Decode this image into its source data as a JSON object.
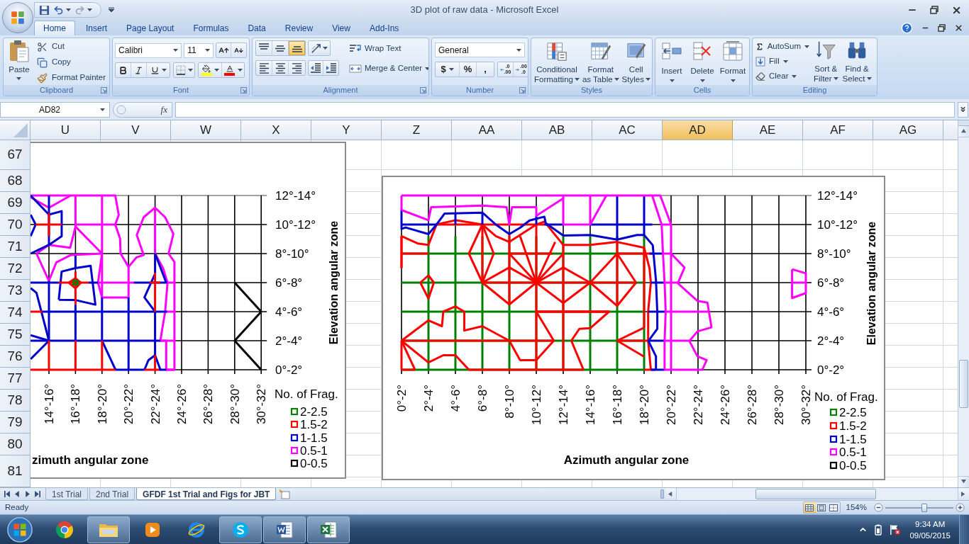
{
  "title_bar": {
    "title": "3D plot of raw data - Microsoft Excel"
  },
  "quick_access": [
    {
      "kind": "save",
      "disabled": false
    },
    {
      "kind": "undo",
      "disabled": false
    },
    {
      "kind": "redo",
      "disabled": true
    }
  ],
  "ribbon_tabs": [
    {
      "label": "Home",
      "selected": true
    },
    {
      "label": "Insert",
      "selected": false
    },
    {
      "label": "Page Layout",
      "selected": false
    },
    {
      "label": "Formulas",
      "selected": false
    },
    {
      "label": "Data",
      "selected": false
    },
    {
      "label": "Review",
      "selected": false
    },
    {
      "label": "View",
      "selected": false
    },
    {
      "label": "Add-Ins",
      "selected": false
    }
  ],
  "ribbon_groups": [
    {
      "kind": "clipboard",
      "name": "Clipboard",
      "paste": "Paste",
      "commands": [
        "Cut",
        "Copy",
        "Format Painter"
      ]
    },
    {
      "kind": "font",
      "name": "Font",
      "font_name": "Calibri",
      "font_size": "11"
    },
    {
      "kind": "alignment",
      "name": "Alignment",
      "vertical_align": [
        {
          "selected": false
        },
        {
          "selected": false
        },
        {
          "selected": true
        }
      ],
      "commands": [
        "Wrap Text",
        "Merge & Center"
      ]
    },
    {
      "kind": "number",
      "name": "Number",
      "format": "General",
      "symbols": [
        "$",
        "%",
        ","
      ],
      "decimals": [
        [
          ".0",
          ".00"
        ],
        [
          ".00",
          ".0"
        ]
      ]
    },
    {
      "kind": "styles",
      "name": "Styles",
      "commands": [
        [
          "Conditional",
          "Formatting"
        ],
        [
          "Format",
          "as Table"
        ],
        [
          "Cell",
          "Styles"
        ]
      ]
    },
    {
      "kind": "cells",
      "name": "Cells",
      "commands": [
        "Insert",
        "Delete",
        "Format"
      ]
    },
    {
      "kind": "editing",
      "name": "Editing",
      "commands": [
        "AutoSum",
        "Fill",
        "Clear"
      ],
      "large_commands": [
        [
          "Sort &",
          "Filter"
        ],
        [
          "Find &",
          "Select"
        ]
      ]
    }
  ],
  "formula_bar": {
    "name_box": "AD82",
    "function_label": "fx"
  },
  "columns": [
    {
      "label": "U",
      "selected": false
    },
    {
      "label": "V",
      "selected": false
    },
    {
      "label": "W",
      "selected": false
    },
    {
      "label": "X",
      "selected": false
    },
    {
      "label": "Y",
      "selected": false
    },
    {
      "label": "Z",
      "selected": false
    },
    {
      "label": "AA",
      "selected": false
    },
    {
      "label": "AB",
      "selected": false
    },
    {
      "label": "AC",
      "selected": false
    },
    {
      "label": "AD",
      "selected": true
    },
    {
      "label": "AE",
      "selected": false
    },
    {
      "label": "AF",
      "selected": false
    },
    {
      "label": "AG",
      "selected": false
    }
  ],
  "rows": [
    "67",
    "68",
    "69",
    "70",
    "71",
    "72",
    "73",
    "74",
    "75",
    "76",
    "77",
    "78",
    "79",
    "80",
    "81"
  ],
  "charts": [
    {
      "kind": "clipped",
      "x_tick_labels": [
        "14°-16°",
        "16°-18°",
        "18°-20°",
        "20°-22°",
        "22°-24°",
        "24°-26°",
        "26°-28°",
        "28°-30°",
        "30°-32°"
      ],
      "y_tick_labels": [
        "12°-14°",
        "10°-12°",
        "8°-10°",
        "6°-8°",
        "4°-6°",
        "2°-4°",
        "0°-2°"
      ],
      "y_axis_title": "Elevation angular zone",
      "x_axis_title": "zimuth angular zone",
      "legend_title": "No. of Frag.",
      "legend": [
        {
          "label": "2-2.5",
          "color": "#008000"
        },
        {
          "label": "1.5-2",
          "color": "#ff0000"
        },
        {
          "label": "1-1.5",
          "color": "#0000cc"
        },
        {
          "label": "0.5-1",
          "color": "#ff00ff"
        },
        {
          "label": "0-0.5",
          "color": "#000000"
        }
      ]
    },
    {
      "kind": "full",
      "x_tick_labels": [
        "0°-2°",
        "2°-4°",
        "4°-6°",
        "6°-8°",
        "8°-10°",
        "10°-12°",
        "12°-14°",
        "14°-16°",
        "16°-18°",
        "18°-20°",
        "20°-22°",
        "22°-24°",
        "24°-26°",
        "26°-28°",
        "28°-30°",
        "30°-32°"
      ],
      "y_tick_labels": [
        "12°-14°",
        "10°-12°",
        "8°-10°",
        "6°-8°",
        "4°-6°",
        "2°-4°",
        "0°-2°"
      ],
      "y_axis_title": "Elevation angular zone",
      "x_axis_title": "Azimuth angular zone",
      "legend_title": "No. of Frag.",
      "legend": [
        {
          "label": "2-2.5",
          "color": "#008000"
        },
        {
          "label": "1.5-2",
          "color": "#ff0000"
        },
        {
          "label": "1-1.5",
          "color": "#0000cc"
        },
        {
          "label": "0.5-1",
          "color": "#ff00ff"
        },
        {
          "label": "0-0.5",
          "color": "#000000"
        }
      ]
    }
  ],
  "sheet_tabs": [
    {
      "label": "1st Trial",
      "selected": false
    },
    {
      "label": "2nd Trial",
      "selected": false
    },
    {
      "label": "GFDF 1st Trial and Figs for JBT",
      "selected": true
    }
  ],
  "status_bar": {
    "status": "Ready",
    "view_buttons": [
      {
        "selected": true
      },
      {
        "selected": false
      },
      {
        "selected": false
      }
    ],
    "zoom": "154%",
    "zoom_slider": {
      "level": 0.57
    }
  },
  "taskbar": {
    "apps": [
      {
        "kind": "chrome",
        "running": false
      },
      {
        "kind": "explorer",
        "running": true
      },
      {
        "kind": "media_player",
        "running": false
      },
      {
        "kind": "ie",
        "running": false
      },
      {
        "kind": "skype",
        "running": true
      },
      {
        "kind": "word",
        "running": true
      },
      {
        "kind": "excel",
        "running": true
      }
    ],
    "time": "9:34 AM",
    "date": "09/05/2015"
  }
}
